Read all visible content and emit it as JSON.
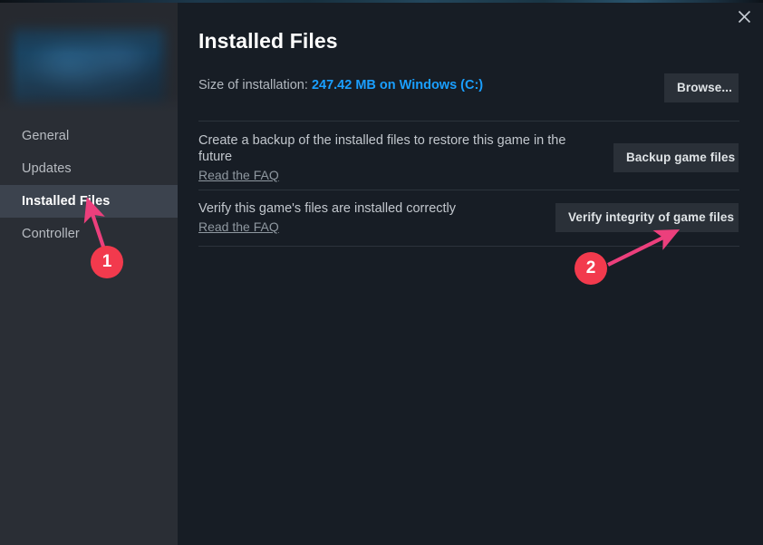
{
  "window": {
    "close_icon": "close-icon"
  },
  "sidebar": {
    "banner_alt": "game-hero-banner",
    "items": [
      {
        "label": "General",
        "active": false
      },
      {
        "label": "Updates",
        "active": false
      },
      {
        "label": "Installed Files",
        "active": true
      },
      {
        "label": "Controller",
        "active": false
      }
    ]
  },
  "main": {
    "title": "Installed Files",
    "size_row": {
      "label": "Size of installation:",
      "value": "247.42 MB on Windows (C:)"
    },
    "browse_button": "Browse...",
    "backup_section": {
      "description": "Create a backup of the installed files to restore this game in the future",
      "faq_link": "Read the FAQ",
      "button": "Backup game files"
    },
    "verify_section": {
      "description": "Verify this game's files are installed correctly",
      "faq_link": "Read the FAQ",
      "button": "Verify integrity of game files"
    }
  },
  "annotations": {
    "marker_color": "#f23a4d",
    "arrow_color": "#ec3f7c",
    "markers": [
      {
        "number": "1",
        "target": "sidebar-item-installed-files"
      },
      {
        "number": "2",
        "target": "verify-integrity-button"
      }
    ]
  },
  "colors": {
    "sidebar_bg": "#2a2e35",
    "main_bg": "#171d25",
    "active_item_bg": "#3c434e",
    "button_bg": "#2a3038",
    "link_blue": "#1a9fff",
    "muted_text": "#8f98a0"
  }
}
